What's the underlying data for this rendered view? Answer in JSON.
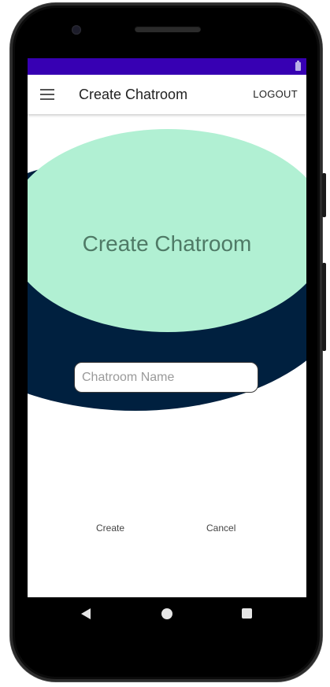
{
  "app_bar": {
    "title": "Create Chatroom",
    "logout_label": "LOGOUT",
    "menu_icon": "hamburger-menu-icon"
  },
  "main": {
    "hero_title": "Create Chatroom",
    "chatroom_name_input": {
      "placeholder": "Chatroom Name",
      "value": ""
    },
    "create_label": "Create",
    "cancel_label": "Cancel"
  },
  "nav_bar": {
    "back_icon": "back-triangle-icon",
    "home_icon": "home-circle-icon",
    "recents_icon": "recents-square-icon"
  },
  "colors": {
    "status_bar": "#3700b3",
    "blob_light": "#b1f0d3",
    "blob_dark": "#00203f",
    "hero_text": "#4f7a66",
    "screen_background": "#ffffff"
  }
}
